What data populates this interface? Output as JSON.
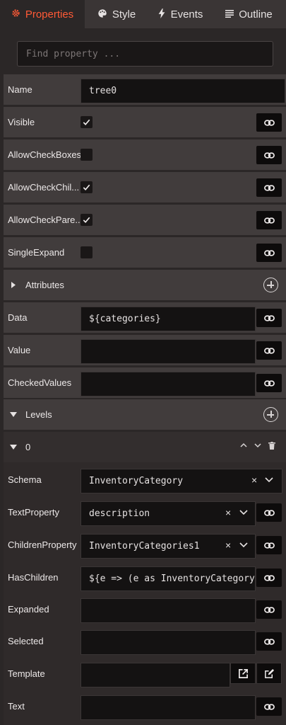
{
  "tabs": [
    {
      "label": "Properties",
      "icon": "gear-icon",
      "active": true
    },
    {
      "label": "Style",
      "icon": "palette-icon",
      "active": false
    },
    {
      "label": "Events",
      "icon": "lightning-icon",
      "active": false
    },
    {
      "label": "Outline",
      "icon": "list-icon",
      "active": false
    }
  ],
  "search": {
    "placeholder": "Find property ..."
  },
  "properties": {
    "name": {
      "label": "Name",
      "value": "tree0"
    },
    "visible": {
      "label": "Visible",
      "checked": true
    },
    "allow_check_boxes": {
      "label": "AllowCheckBoxes",
      "checked": false
    },
    "allow_check_children": {
      "label": "AllowCheckChil...",
      "checked": true
    },
    "allow_check_parents": {
      "label": "AllowCheckPare...",
      "checked": true
    },
    "single_expand": {
      "label": "SingleExpand",
      "checked": false
    },
    "attributes": {
      "label": "Attributes"
    },
    "data": {
      "label": "Data",
      "value": "${categories}"
    },
    "value": {
      "label": "Value",
      "value": ""
    },
    "checked_values": {
      "label": "CheckedValues",
      "value": ""
    },
    "levels": {
      "label": "Levels"
    }
  },
  "level0": {
    "title": "0",
    "schema": {
      "label": "Schema",
      "value": "InventoryCategory"
    },
    "text_property": {
      "label": "TextProperty",
      "value": "description"
    },
    "children_property": {
      "label": "ChildrenProperty",
      "value": "InventoryCategories1"
    },
    "has_children": {
      "label": "HasChildren",
      "value": "${e => (e as InventoryCategory"
    },
    "expanded": {
      "label": "Expanded",
      "value": ""
    },
    "selected": {
      "label": "Selected",
      "value": ""
    },
    "template": {
      "label": "Template",
      "value": ""
    },
    "text": {
      "label": "Text",
      "value": ""
    }
  },
  "colors": {
    "accent": "#ff5a36",
    "row_bg": "#413c3c",
    "field_bg": "#141212"
  }
}
